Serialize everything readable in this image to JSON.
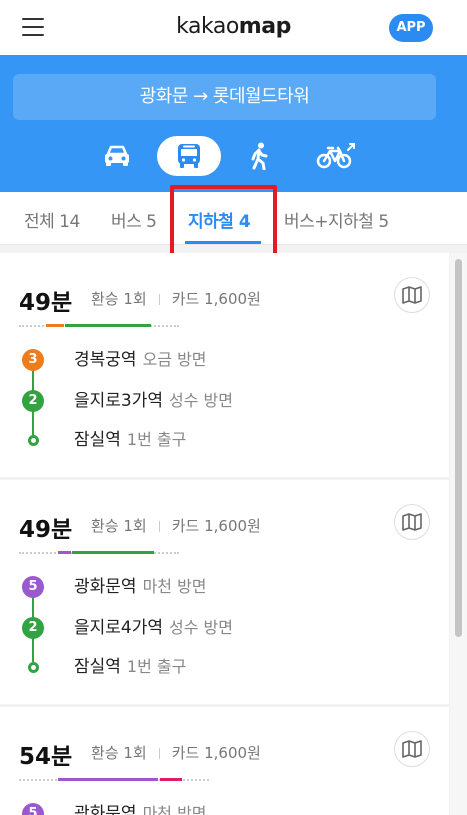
{
  "app": {
    "logo_light": "kakao",
    "logo_bold": "map",
    "app_button": "APP"
  },
  "route": {
    "text": "광화문 → 롯데월드타워"
  },
  "modes": [
    {
      "name": "car-icon",
      "active": false
    },
    {
      "name": "bus-icon",
      "active": true
    },
    {
      "name": "walk-icon",
      "active": false
    },
    {
      "name": "bike-icon",
      "active": false
    }
  ],
  "tabs": [
    {
      "label": "전체 14",
      "active": false
    },
    {
      "label": "버스 5",
      "active": false
    },
    {
      "label": "지하철 4",
      "active": true
    },
    {
      "label": "버스+지하철 5",
      "active": false
    }
  ],
  "colors": {
    "accent": "#2b8bf2",
    "header_bg": "#3596f5",
    "highlight": "#e31b23",
    "line2": "#33a241",
    "line3": "#ef7c1c",
    "line5": "#996cac",
    "line8": "#e6186c"
  },
  "routes": [
    {
      "time": "49분",
      "transfer": "환승 1회",
      "fare": "카드 1,600원",
      "segments": [
        {
          "color": "#ef7c1c",
          "fraction": 0.11
        },
        {
          "color": "#33a241",
          "fraction": 0.52
        }
      ],
      "stops": [
        {
          "badge": "3",
          "color": "#ef7c1c",
          "name": "경복궁역",
          "dir": "오금 방면"
        },
        {
          "badge": "2",
          "color": "#33a241",
          "name": "을지로3가역",
          "dir": "성수 방면"
        },
        {
          "badge": "",
          "color": "#33a241",
          "name": "잠실역",
          "dir": "1번 출구"
        }
      ]
    },
    {
      "time": "49분",
      "transfer": "환승 1회",
      "fare": "카드 1,600원",
      "segments": [
        {
          "color": "#9b59d0",
          "fraction": 0.08
        },
        {
          "color": "#33a241",
          "fraction": 0.52
        }
      ],
      "stops": [
        {
          "badge": "5",
          "color": "#9b59d0",
          "name": "광화문역",
          "dir": "마천 방면"
        },
        {
          "badge": "2",
          "color": "#33a241",
          "name": "을지로4가역",
          "dir": "성수 방면"
        },
        {
          "badge": "",
          "color": "#33a241",
          "name": "잠실역",
          "dir": "1번 출구"
        }
      ]
    },
    {
      "time": "54분",
      "transfer": "환승 1회",
      "fare": "카드 1,600원",
      "segments": [
        {
          "color": "#9b59d0",
          "fraction": 0.62
        },
        {
          "color": "#e6186c",
          "fraction": 0.14
        }
      ],
      "stops": [
        {
          "badge": "5",
          "color": "#9b59d0",
          "name": "광화문역",
          "dir": "마천 방면"
        }
      ]
    }
  ]
}
